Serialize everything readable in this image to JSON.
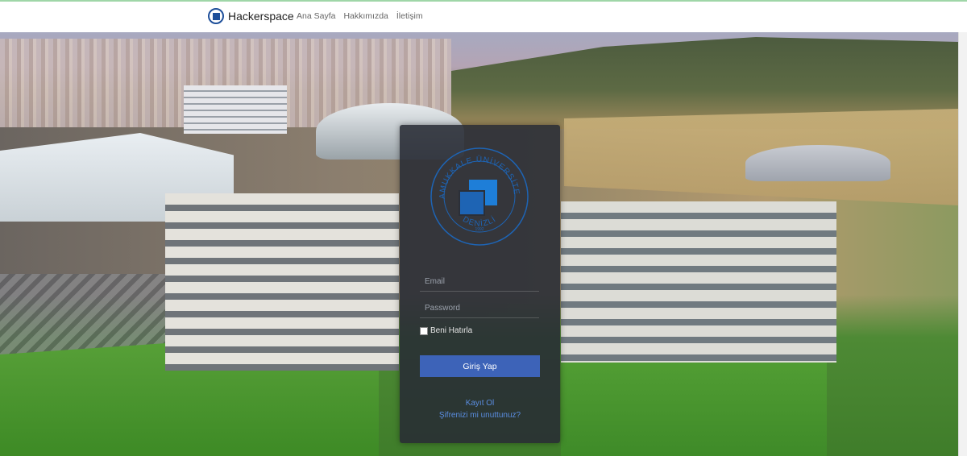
{
  "navbar": {
    "brand": "Hackerspace",
    "links": [
      "Ana Sayfa",
      "Hakkımızda",
      "İletişim"
    ]
  },
  "login": {
    "logo": {
      "top_text": "PAMUKKALE ÜNİVERSİTESİ",
      "year": "1992",
      "city": "DENİZLİ"
    },
    "email_placeholder": "Email",
    "password_placeholder": "Password",
    "remember_label": "Beni Hatırla",
    "submit_label": "Giriş Yap",
    "register_link": "Kayıt Ol",
    "forgot_link": "Şifrenizi mi unuttunuz?"
  },
  "colors": {
    "primary_button": "#3d63b8",
    "link": "#5a8de0",
    "seal_blue": "#1e64b4"
  }
}
